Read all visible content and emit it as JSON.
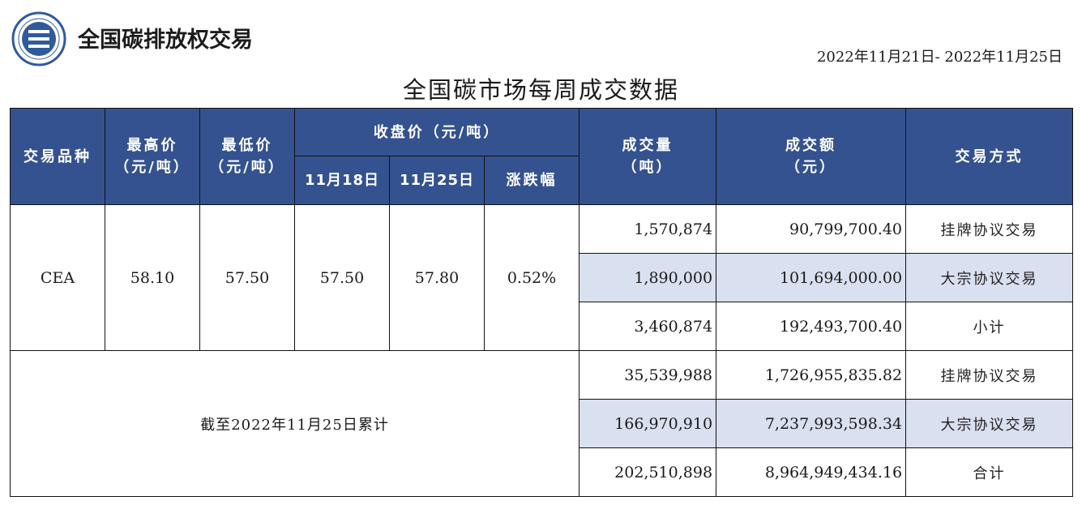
{
  "header": {
    "brand": "全国碳排放权交易",
    "date_range": "2022年11月21日- 2022年11月25日",
    "title": "全国碳市场每周成交数据"
  },
  "table": {
    "headers": {
      "product": "交易品种",
      "high": "最高价",
      "high_unit": "（元/吨）",
      "low": "最低价",
      "low_unit": "（元/吨）",
      "close": "收盘价（元/吨）",
      "close_date1": "11月18日",
      "close_date2": "11月25日",
      "change": "涨跌幅",
      "volume": "成交量",
      "volume_unit": "（吨）",
      "amount": "成交额",
      "amount_unit": "（元）",
      "method": "交易方式"
    },
    "weekly": {
      "product": "CEA",
      "high": "58.10",
      "low": "57.50",
      "close_prev": "57.50",
      "close_curr": "57.80",
      "change": "0.52%",
      "rows": [
        {
          "volume": "1,570,874",
          "amount": "90,799,700.40",
          "method": "挂牌协议交易"
        },
        {
          "volume": "1,890,000",
          "amount": "101,694,000.00",
          "method": "大宗协议交易"
        },
        {
          "volume": "3,460,874",
          "amount": "192,493,700.40",
          "method": "小计"
        }
      ]
    },
    "cumulative": {
      "label": "截至2022年11月25日累计",
      "rows": [
        {
          "volume": "35,539,988",
          "amount": "1,726,955,835.82",
          "method": "挂牌协议交易"
        },
        {
          "volume": "166,970,910",
          "amount": "7,237,993,598.34",
          "method": "大宗协议交易"
        },
        {
          "volume": "202,510,898",
          "amount": "8,964,949,434.16",
          "method": "合计"
        }
      ]
    }
  }
}
